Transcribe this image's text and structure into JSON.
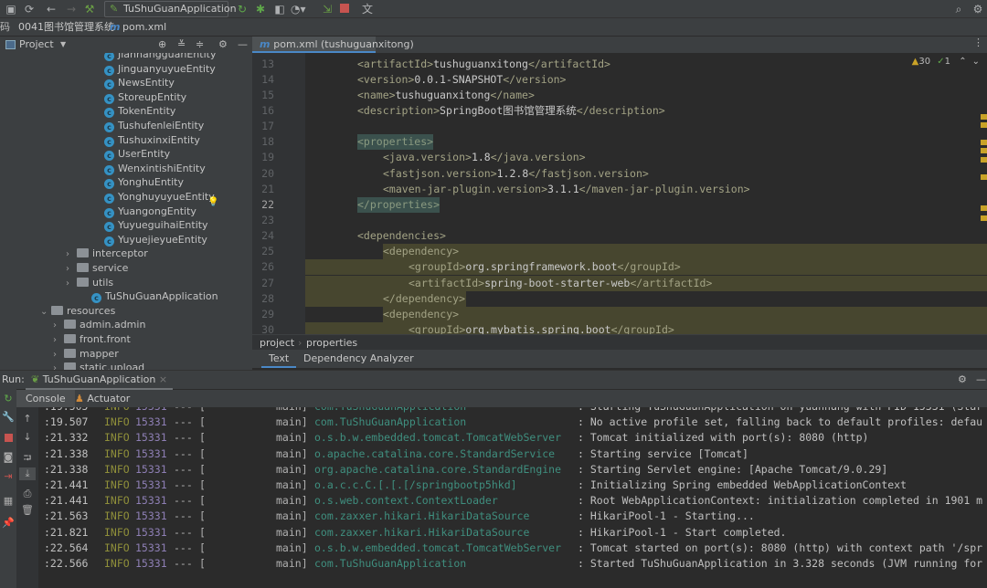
{
  "toolbar": {
    "run_config": "TuShuGuanApplication",
    "icons": [
      "save-icon",
      "sync-icon",
      "back-icon",
      "forward-icon",
      "build-hammer-icon",
      "rerun-icon",
      "debug-icon",
      "coverage-icon",
      "profile-icon",
      "attach-icon",
      "stop-icon",
      "translate-icon",
      "search-icon",
      "settings-icon"
    ]
  },
  "breadcrumb": {
    "prefix": "码",
    "project": "0041图书馆管理系统",
    "file": "pom.xml"
  },
  "project_panel": {
    "title": "Project",
    "items": [
      {
        "label": "JianhangguanEntity",
        "type": "class",
        "indent": 114
      },
      {
        "label": "JinguanyuyueEntity",
        "type": "class",
        "indent": 114
      },
      {
        "label": "NewsEntity",
        "type": "class",
        "indent": 114
      },
      {
        "label": "StoreupEntity",
        "type": "class",
        "indent": 114
      },
      {
        "label": "TokenEntity",
        "type": "class",
        "indent": 114
      },
      {
        "label": "TushufenleiEntity",
        "type": "class",
        "indent": 114
      },
      {
        "label": "TushuxinxiEntity",
        "type": "class",
        "indent": 114
      },
      {
        "label": "UserEntity",
        "type": "class",
        "indent": 114
      },
      {
        "label": "WenxintishiEntity",
        "type": "class",
        "indent": 114
      },
      {
        "label": "YonghuEntity",
        "type": "class",
        "indent": 114
      },
      {
        "label": "YonghuyuyueEntity",
        "type": "class",
        "indent": 114
      },
      {
        "label": "YuangongEntity",
        "type": "class",
        "indent": 114
      },
      {
        "label": "YuyueguihaiEntity",
        "type": "class",
        "indent": 114
      },
      {
        "label": "YuyuejieyueEntity",
        "type": "class",
        "indent": 114
      },
      {
        "label": "interceptor",
        "type": "folder-collapsed",
        "indent": 86
      },
      {
        "label": "service",
        "type": "folder-collapsed",
        "indent": 86
      },
      {
        "label": "utils",
        "type": "folder-collapsed",
        "indent": 86
      },
      {
        "label": "TuShuGuanApplication",
        "type": "app",
        "indent": 100
      },
      {
        "label": "resources",
        "type": "folder-expanded",
        "indent": 58
      },
      {
        "label": "admin.admin",
        "type": "folder-collapsed",
        "indent": 72
      },
      {
        "label": "front.front",
        "type": "folder-collapsed",
        "indent": 72
      },
      {
        "label": "mapper",
        "type": "folder-collapsed",
        "indent": 72
      },
      {
        "label": "static.upload",
        "type": "folder-collapsed",
        "indent": 72
      }
    ]
  },
  "editor": {
    "tab": "pom.xml (tushuguanxitong)",
    "warnings": "30",
    "weak_warnings": "1",
    "lines": [
      {
        "n": "13",
        "indent": 1,
        "parts": [
          [
            "tag",
            "<artifactId>"
          ],
          [
            "txt",
            "tushuguanxitong"
          ],
          [
            "tag",
            "</artifactId>"
          ]
        ]
      },
      {
        "n": "14",
        "indent": 1,
        "parts": [
          [
            "tag",
            "<version>"
          ],
          [
            "txt",
            "0.0.1-SNAPSHOT"
          ],
          [
            "tag",
            "</version>"
          ]
        ]
      },
      {
        "n": "15",
        "indent": 1,
        "parts": [
          [
            "tag",
            "<name>"
          ],
          [
            "txt",
            "tushuguanxitong"
          ],
          [
            "tag",
            "</name>"
          ]
        ]
      },
      {
        "n": "16",
        "indent": 1,
        "parts": [
          [
            "tag",
            "<description>"
          ],
          [
            "txt",
            "SpringBoot图书馆管理系统"
          ],
          [
            "tag",
            "</description>"
          ]
        ]
      },
      {
        "n": "17",
        "indent": 0,
        "parts": []
      },
      {
        "n": "18",
        "indent": 1,
        "hl": "match",
        "parts": [
          [
            "tag",
            "<properties>"
          ]
        ]
      },
      {
        "n": "19",
        "indent": 2,
        "parts": [
          [
            "tag",
            "<java.version>"
          ],
          [
            "txt",
            "1.8"
          ],
          [
            "tag",
            "</java.version>"
          ]
        ]
      },
      {
        "n": "20",
        "indent": 2,
        "parts": [
          [
            "tag",
            "<fastjson.version>"
          ],
          [
            "txt",
            "1.2.8"
          ],
          [
            "tag",
            "</fastjson.version>"
          ]
        ]
      },
      {
        "n": "21",
        "indent": 2,
        "parts": [
          [
            "tag",
            "<maven-jar-plugin.version>"
          ],
          [
            "txt",
            "3.1.1"
          ],
          [
            "tag",
            "</maven-jar-plugin.version>"
          ]
        ]
      },
      {
        "n": "22",
        "indent": 1,
        "hl": "match",
        "current": true,
        "parts": [
          [
            "tag",
            "</properties>"
          ]
        ]
      },
      {
        "n": "23",
        "indent": 0,
        "parts": []
      },
      {
        "n": "24",
        "indent": 1,
        "parts": [
          [
            "tag",
            "<dependencies>"
          ]
        ]
      },
      {
        "n": "25",
        "indent": 2,
        "hl": "dep",
        "parts": [
          [
            "tag",
            "<dependency>"
          ]
        ]
      },
      {
        "n": "26",
        "indent": 3,
        "hl": "depfull",
        "parts": [
          [
            "tag",
            "<groupId>"
          ],
          [
            "txt",
            "org.springframework.boot"
          ],
          [
            "tag",
            "</groupId>"
          ]
        ]
      },
      {
        "n": "27",
        "indent": 3,
        "hl": "depfull",
        "parts": [
          [
            "tag",
            "<artifactId>"
          ],
          [
            "txt",
            "spring-boot-starter-web"
          ],
          [
            "tag",
            "</artifactId>"
          ]
        ]
      },
      {
        "n": "28",
        "indent": 2,
        "hl": "depend",
        "parts": [
          [
            "tag",
            "</dependency>"
          ]
        ]
      },
      {
        "n": "29",
        "indent": 2,
        "hl": "dep",
        "parts": [
          [
            "tag",
            "<dependency>"
          ]
        ]
      },
      {
        "n": "30",
        "indent": 3,
        "hl": "depfull",
        "parts": [
          [
            "tag",
            "<groupId>"
          ],
          [
            "txt",
            "org.mybatis.spring.boot"
          ],
          [
            "tag",
            "</groupId>"
          ]
        ]
      }
    ],
    "breadcrumb": [
      "project",
      "properties"
    ],
    "bottom_tabs": [
      "Text",
      "Dependency Analyzer"
    ]
  },
  "run": {
    "label": "Run:",
    "config": "TuShuGuanApplication",
    "tabs": [
      "Console",
      "Actuator"
    ],
    "lines": [
      {
        "t": ":19.505",
        "lvl": "INFO",
        "pid": "15331",
        "sep": "---",
        "th": "main]",
        "logger": "com.TuShuGuanApplication",
        "msg": ": Starting TuShuGuanApplication on yuanhang with PID 15331 (Star"
      },
      {
        "t": ":19.507",
        "lvl": "INFO",
        "pid": "15331",
        "sep": "---",
        "th": "main]",
        "logger": "com.TuShuGuanApplication",
        "msg": ": No active profile set, falling back to default profiles: defau"
      },
      {
        "t": ":21.332",
        "lvl": "INFO",
        "pid": "15331",
        "sep": "---",
        "th": "main]",
        "logger": "o.s.b.w.embedded.tomcat.TomcatWebServer",
        "msg": ": Tomcat initialized with port(s): 8080 (http)"
      },
      {
        "t": ":21.338",
        "lvl": "INFO",
        "pid": "15331",
        "sep": "---",
        "th": "main]",
        "logger": "o.apache.catalina.core.StandardService",
        "msg": ": Starting service [Tomcat]"
      },
      {
        "t": ":21.338",
        "lvl": "INFO",
        "pid": "15331",
        "sep": "---",
        "th": "main]",
        "logger": "org.apache.catalina.core.StandardEngine",
        "msg": ": Starting Servlet engine: [Apache Tomcat/9.0.29]"
      },
      {
        "t": ":21.441",
        "lvl": "INFO",
        "pid": "15331",
        "sep": "---",
        "th": "main]",
        "logger": "o.a.c.c.C.[.[.[/springbootp5hkd]",
        "msg": ": Initializing Spring embedded WebApplicationContext"
      },
      {
        "t": ":21.441",
        "lvl": "INFO",
        "pid": "15331",
        "sep": "---",
        "th": "main]",
        "logger": "o.s.web.context.ContextLoader",
        "msg": ": Root WebApplicationContext: initialization completed in 1901 m"
      },
      {
        "t": ":21.563",
        "lvl": "INFO",
        "pid": "15331",
        "sep": "---",
        "th": "main]",
        "logger": "com.zaxxer.hikari.HikariDataSource",
        "msg": ": HikariPool-1 - Starting..."
      },
      {
        "t": ":21.821",
        "lvl": "INFO",
        "pid": "15331",
        "sep": "---",
        "th": "main]",
        "logger": "com.zaxxer.hikari.HikariDataSource",
        "msg": ": HikariPool-1 - Start completed."
      },
      {
        "t": ":22.564",
        "lvl": "INFO",
        "pid": "15331",
        "sep": "---",
        "th": "main]",
        "logger": "o.s.b.w.embedded.tomcat.TomcatWebServer",
        "msg": ": Tomcat started on port(s): 8080 (http) with context path '/spr"
      },
      {
        "t": ":22.566",
        "lvl": "INFO",
        "pid": "15331",
        "sep": "---",
        "th": "main]",
        "logger": "com.TuShuGuanApplication",
        "msg": ": Started TuShuGuanApplication in 3.328 seconds (JVM running for"
      }
    ]
  },
  "colors": {
    "accent": "#4a88c7",
    "warning": "#c9a227",
    "stop": "#c75450"
  }
}
